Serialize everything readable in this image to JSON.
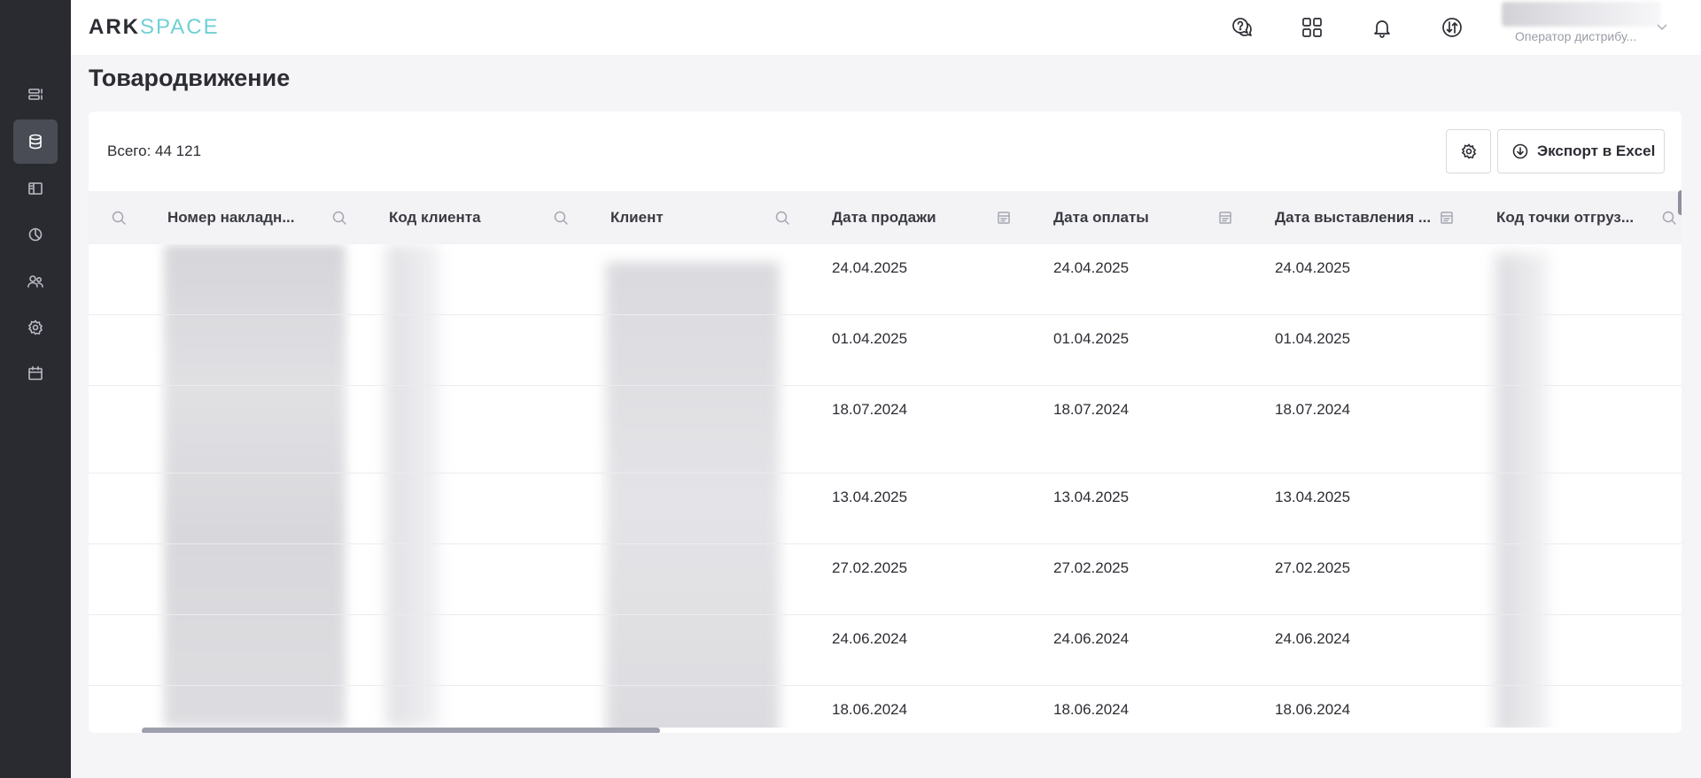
{
  "logo": {
    "part1": "ARK",
    "part2": "SPACE"
  },
  "header": {
    "icons": [
      "chat-help-icon",
      "apps-grid-icon",
      "bell-icon",
      "sync-icon"
    ],
    "user_role": "Оператор дистрибу..."
  },
  "sidebar": {
    "items": [
      {
        "name": "list-icon",
        "active": false
      },
      {
        "name": "database-icon",
        "active": true
      },
      {
        "name": "book-icon",
        "active": false
      },
      {
        "name": "pie-chart-icon",
        "active": false
      },
      {
        "name": "users-icon",
        "active": false
      },
      {
        "name": "gear-icon",
        "active": false
      },
      {
        "name": "calendar-icon",
        "active": false
      }
    ]
  },
  "page": {
    "title": "Товародвижение"
  },
  "toolbar": {
    "total": "Всего: 44 121",
    "export_label": "Экспорт в Excel"
  },
  "table": {
    "columns": [
      {
        "label": "",
        "icon": "search-icon"
      },
      {
        "label": "Номер накладн...",
        "icon": "search-icon"
      },
      {
        "label": "Код клиента",
        "icon": "search-icon"
      },
      {
        "label": "Клиент",
        "icon": "search-icon"
      },
      {
        "label": "Дата продажи",
        "icon": "calendar-filter-icon"
      },
      {
        "label": "Дата оплаты",
        "icon": "calendar-filter-icon"
      },
      {
        "label": "Дата выставления ...",
        "icon": "calendar-filter-icon"
      },
      {
        "label": "Код точки отгруз...",
        "icon": "search-icon"
      }
    ],
    "rows": [
      {
        "sale_date": "24.04.2025",
        "payment_date": "24.04.2025",
        "invoice_date": "24.04.2025"
      },
      {
        "sale_date": "01.04.2025",
        "payment_date": "01.04.2025",
        "invoice_date": "01.04.2025"
      },
      {
        "sale_date": "18.07.2024",
        "payment_date": "18.07.2024",
        "invoice_date": "18.07.2024"
      },
      {
        "sale_date": "13.04.2025",
        "payment_date": "13.04.2025",
        "invoice_date": "13.04.2025"
      },
      {
        "sale_date": "27.02.2025",
        "payment_date": "27.02.2025",
        "invoice_date": "27.02.2025"
      },
      {
        "sale_date": "24.06.2024",
        "payment_date": "24.06.2024",
        "invoice_date": "24.06.2024"
      },
      {
        "sale_date": "18.06.2024",
        "payment_date": "18.06.2024",
        "invoice_date": "18.06.2024"
      }
    ]
  },
  "colors": {
    "sidebar_bg": "#2a2b31",
    "accent": "#6fd0d4",
    "page_bg": "#f5f5f8"
  }
}
